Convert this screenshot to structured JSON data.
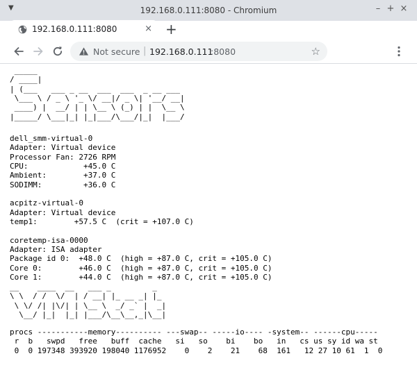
{
  "window": {
    "title": "192.168.0.111:8080 - Chromium",
    "menu_glyph": "▼",
    "minimize_glyph": "–",
    "maximize_glyph": "+",
    "close_glyph": "×"
  },
  "tab": {
    "title": "192.168.0.111:8080",
    "close_glyph": "×",
    "new_tab_glyph": "+"
  },
  "omnibox": {
    "security_label": "Not secure",
    "separator": "|",
    "url_host": "192.168.0.111",
    "url_port": ":8080",
    "bookmark_glyph": "☆"
  },
  "page": {
    "sensors_banner": " _____\n/ ____|\n| (___   ___ _ __  ___  ___  _ __ ___\n \\___ \\ / _ \\ '_ \\/ __|/ _ \\| '__/ __|\n ____) |  __/ | | \\__ \\ (_) | |  \\__ \\\n|_____/ \\___|_| |_|___/\\___/|_|  |___/",
    "sensors_output": "dell_smm-virtual-0\nAdapter: Virtual device\nProcessor Fan: 2726 RPM\nCPU:            +45.0 C\nAmbient:        +37.0 C\nSODIMM:         +36.0 C\n\nacpitz-virtual-0\nAdapter: Virtual device\ntemp1:        +57.5 C  (crit = +107.0 C)\n\ncoretemp-isa-0000\nAdapter: ISA adapter\nPackage id 0:  +48.0 C  (high = +87.0 C, crit = +105.0 C)\nCore 0:        +46.0 C  (high = +87.0 C, crit = +105.0 C)\nCore 1:        +44.0 C  (high = +87.0 C, crit = +105.0 C)",
    "vmstat_banner": "__    ____  __   ___ _         _\n\\ \\  / /  \\/  | / __| |_ __ _| |_\n \\ \\/ /| |\\/| | \\__ \\  _/ _` |  _|\n  \\__/ |_|  |_| |___/\\__\\__,_|\\__|",
    "vmstat_output": "procs -----------memory---------- ---swap-- -----io---- -system-- ------cpu-----\n r  b   swpd   free   buff  cache   si   so    bi    bo   in   cs us sy id wa st\n 0  0 197348 393920 198040 1176952    0    2    21    68  161   12 27 10 61  1  0"
  },
  "colors": {
    "titlebar": "#dee1e6",
    "toolbar": "#ffffff",
    "omnibox": "#f1f3f4",
    "page_bg": "#ffffff",
    "text": "#000000"
  },
  "icons": {
    "favicon": "globe-icon",
    "back": "arrow-left-icon",
    "forward": "arrow-right-icon",
    "reload": "reload-icon",
    "security": "warning-triangle-icon",
    "bookmark": "star-icon",
    "menu": "kebab-menu-icon"
  }
}
